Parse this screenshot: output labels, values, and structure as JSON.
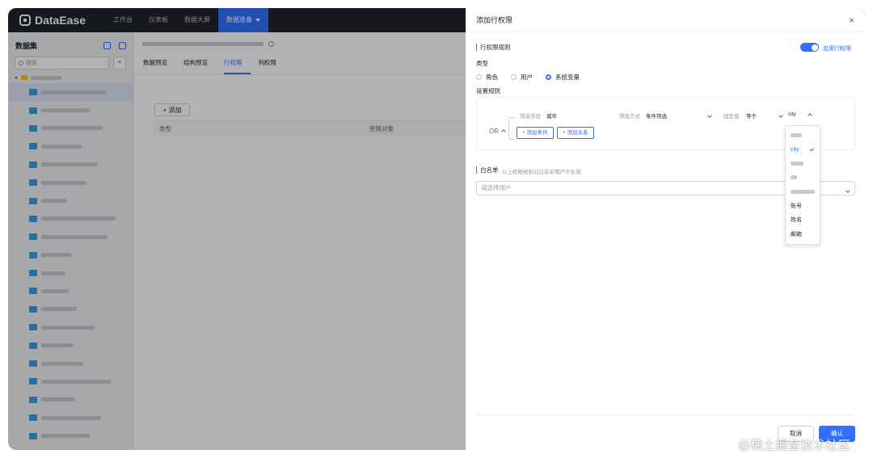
{
  "app": {
    "logo": "DataEase",
    "nav": [
      "工作台",
      "仪表板",
      "数据大屏",
      "数据准备"
    ]
  },
  "sidebar": {
    "title": "数据集",
    "search_placeholder": "搜索",
    "sort_label": "≡"
  },
  "main": {
    "tabs": [
      "数据预览",
      "结构预览",
      "行权限",
      "列权限"
    ],
    "add_button": "+ 添加",
    "columns": [
      "类型",
      "受限对象"
    ]
  },
  "drawer": {
    "title": "添加行权限",
    "close": "×",
    "rule_section": "行权限规则",
    "toggle_label": "启用行权限",
    "type_label": "类型",
    "type_options": [
      "角色",
      "用户",
      "系统变量"
    ],
    "rules_label": "设置规则",
    "logic": "OR",
    "filter_field_label": "筛选字段",
    "filter_field_value": "城市",
    "filter_mode_label": "筛选方式",
    "filter_mode_value": "条件筛选",
    "fixed_value_label": "固定值",
    "operator_value": "等于",
    "variable_value": "city",
    "add_condition": "+ 添加条件",
    "add_relation": "+ 添加关系",
    "whitelist_title": "白名单",
    "whitelist_hint": "以上权限规则对白名单用户不生效",
    "whitelist_placeholder": "请选择用户",
    "dropdown_options": [
      "city",
      "账号",
      "姓名",
      "邮箱"
    ],
    "cancel_button": "取消",
    "confirm_button": "确认"
  },
  "watermark": "@稀土掘金技术社区",
  "colors": {
    "accent": "#3370ff",
    "nav_bg": "#1f2329"
  }
}
